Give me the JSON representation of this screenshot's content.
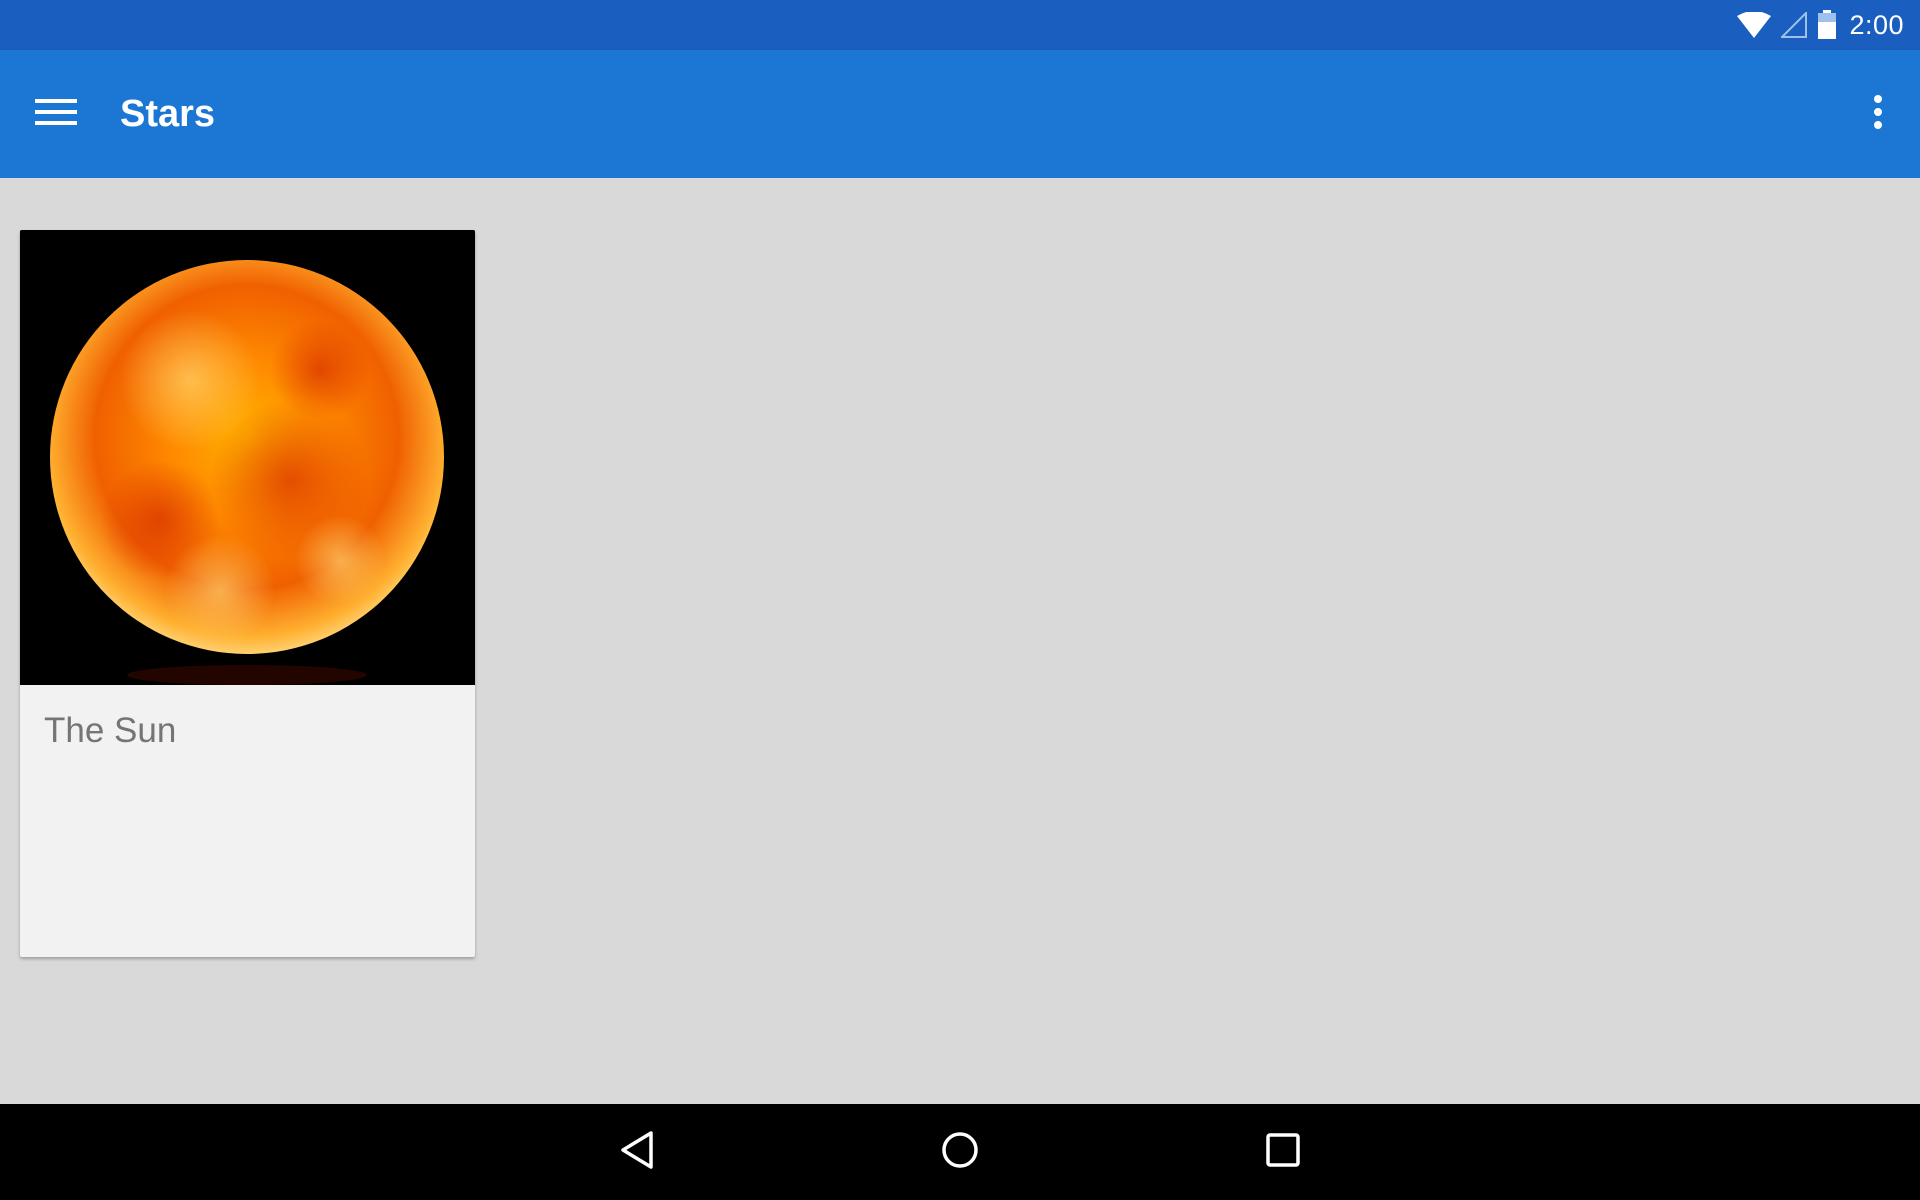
{
  "status_bar": {
    "time": "2:00",
    "icons": [
      "wifi-icon",
      "cell-signal-icon",
      "battery-icon"
    ]
  },
  "app_bar": {
    "title": "Stars",
    "menu_icon": "hamburger-menu-icon",
    "overflow_icon": "more-vert-icon",
    "color": "#1b77d3"
  },
  "cards": [
    {
      "label": "The Sun",
      "image": "sun-image"
    }
  ],
  "nav_bar": {
    "buttons": [
      "back-icon",
      "home-icon",
      "recents-icon"
    ]
  },
  "colors": {
    "status_bar": "#1a5fbf",
    "app_bar": "#1b77d3",
    "background": "#d9d9d9",
    "card": "#f2f2f2",
    "card_text": "#757575"
  }
}
